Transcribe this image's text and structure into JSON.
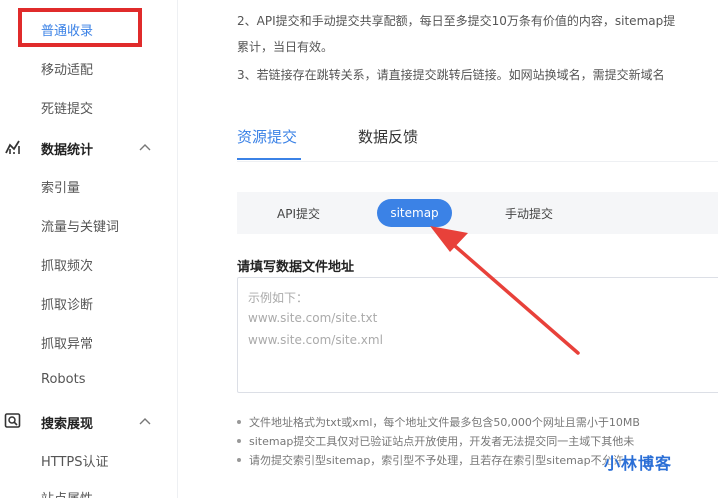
{
  "sidebar": {
    "items_top": [
      {
        "label": "普通收录",
        "active": true
      },
      {
        "label": "移动适配",
        "active": false
      },
      {
        "label": "死链提交",
        "active": false
      }
    ],
    "section_stats": {
      "label": "数据统计",
      "icon": "chart-line-icon"
    },
    "stats_items": [
      {
        "label": "索引量"
      },
      {
        "label": "流量与关键词"
      },
      {
        "label": "抓取频次"
      },
      {
        "label": "抓取诊断"
      },
      {
        "label": "抓取异常"
      },
      {
        "label": "Robots"
      }
    ],
    "section_search": {
      "label": "搜索展现",
      "icon": "search-box-icon"
    },
    "search_items": [
      {
        "label": "HTTPS认证"
      },
      {
        "label": "站点属性"
      }
    ]
  },
  "notices": {
    "line1": "2、API提交和手动提交共享配额，每日至多提交10万条有价值的内容，sitemap提",
    "line2": "累计，当日有效。",
    "line3": "3、若链接存在跳转关系，请直接提交跳转后链接。如网站换域名，需提交新域名"
  },
  "tabs": {
    "resource_submit": "资源提交",
    "data_feedback": "数据反馈"
  },
  "subtabs": {
    "api": "API提交",
    "sitemap": "sitemap",
    "manual": "手动提交"
  },
  "form": {
    "label": "请填写数据文件地址",
    "placeholder_lines": [
      "示例如下：",
      "www.site.com/site.txt",
      "www.site.com/site.xml"
    ]
  },
  "bullets": [
    "文件地址格式为txt或xml，每个地址文件最多包含50,000个网址且需小于10MB",
    "sitemap提交工具仅对已验证站点开放使用，开发者无法提交同一主域下其他未",
    "请勿提交索引型sitemap，索引型不予处理，且若存在索引型sitemap不允许"
  ],
  "watermark": "小林博客",
  "colors": {
    "accent": "#3b82e6",
    "highlight": "#e02b2b",
    "arrow": "#e8413a"
  }
}
